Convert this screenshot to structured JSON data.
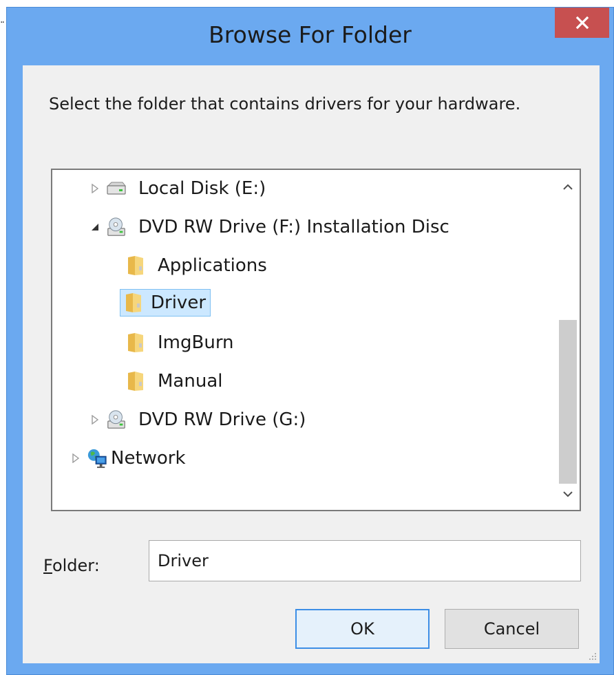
{
  "window": {
    "title": "Browse For Folder",
    "close_icon": "close-icon",
    "accent_color": "#6ba9f0",
    "close_color": "#c75050"
  },
  "instruction": "Select the folder that contains drivers for your hardware.",
  "tree": {
    "items": [
      {
        "label": "Local Disk (E:)",
        "icon": "drive-icon",
        "expander": "collapsed",
        "level": 1
      },
      {
        "label": "DVD RW Drive (F:) Installation Disc",
        "icon": "dvd-drive-icon",
        "expander": "expanded",
        "level": 1
      },
      {
        "label": "Applications",
        "icon": "folder-icon",
        "expander": "none",
        "level": 2
      },
      {
        "label": "Driver",
        "icon": "folder-icon",
        "expander": "none",
        "level": 2,
        "selected": true
      },
      {
        "label": "ImgBurn",
        "icon": "folder-icon",
        "expander": "none",
        "level": 2
      },
      {
        "label": "Manual",
        "icon": "folder-icon",
        "expander": "none",
        "level": 2
      },
      {
        "label": "DVD RW Drive (G:)",
        "icon": "dvd-drive-icon",
        "expander": "collapsed",
        "level": 1
      },
      {
        "label": "Network",
        "icon": "network-icon",
        "expander": "collapsed",
        "level": 0
      }
    ],
    "selection_color": "#cce8ff"
  },
  "folder": {
    "label_underlined": "F",
    "label_rest": "older:",
    "value": "Driver"
  },
  "buttons": {
    "ok": "OK",
    "cancel": "Cancel"
  }
}
